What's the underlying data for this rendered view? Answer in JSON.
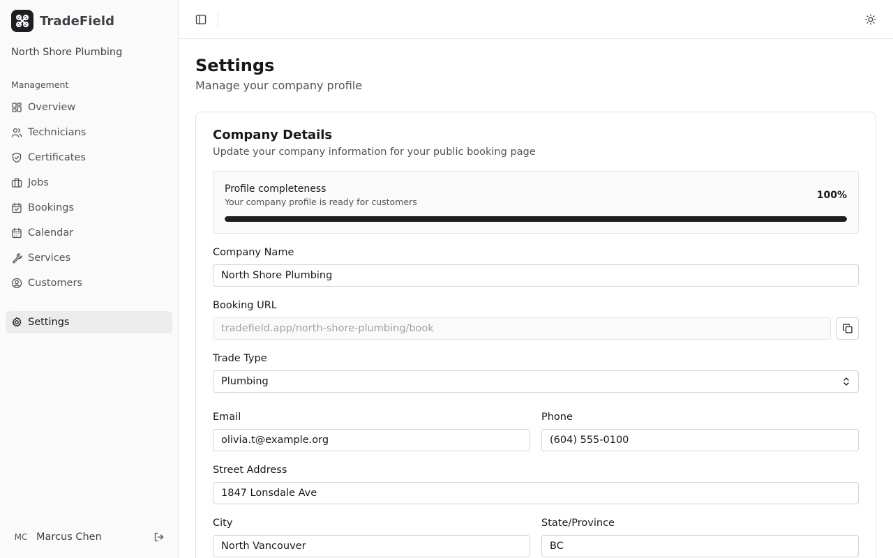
{
  "app": {
    "name": "TradeField",
    "company": "North Shore Plumbing"
  },
  "sidebar": {
    "group_label": "Management",
    "items": [
      {
        "label": "Overview",
        "icon": "grid-icon"
      },
      {
        "label": "Technicians",
        "icon": "users-icon"
      },
      {
        "label": "Certificates",
        "icon": "shield-check-icon"
      },
      {
        "label": "Jobs",
        "icon": "briefcase-icon"
      },
      {
        "label": "Bookings",
        "icon": "calendar-check-icon"
      },
      {
        "label": "Calendar",
        "icon": "calendar-icon"
      },
      {
        "label": "Services",
        "icon": "wrench-icon"
      },
      {
        "label": "Customers",
        "icon": "user-circle-icon"
      },
      {
        "label": "Settings",
        "icon": "gear-icon",
        "active": true
      }
    ],
    "user": {
      "initials": "MC",
      "name": "Marcus Chen"
    }
  },
  "page": {
    "title": "Settings",
    "subtitle": "Manage your company profile"
  },
  "card": {
    "title": "Company Details",
    "description": "Update your company information for your public booking page",
    "progress": {
      "title": "Profile completeness",
      "description": "Your company profile is ready for customers",
      "value_label": "100%",
      "value": 100
    },
    "fields": {
      "company_name": {
        "label": "Company Name",
        "value": "North Shore Plumbing"
      },
      "booking_url": {
        "label": "Booking URL",
        "value": "tradefield.app/north-shore-plumbing/book"
      },
      "trade_type": {
        "label": "Trade Type",
        "value": "Plumbing"
      },
      "email": {
        "label": "Email",
        "value": "olivia.t@example.org"
      },
      "phone": {
        "label": "Phone",
        "value": "(604) 555-0100"
      },
      "street": {
        "label": "Street Address",
        "value": "1847 Lonsdale Ave"
      },
      "city": {
        "label": "City",
        "value": "North Vancouver"
      },
      "state": {
        "label": "State/Province",
        "value": "BC"
      }
    }
  },
  "colors": {
    "primary": "#1f1f23",
    "border": "#e4e4e7",
    "sidebar_bg": "#fafafa",
    "active_bg": "#ececee",
    "muted_text": "#52525b"
  }
}
